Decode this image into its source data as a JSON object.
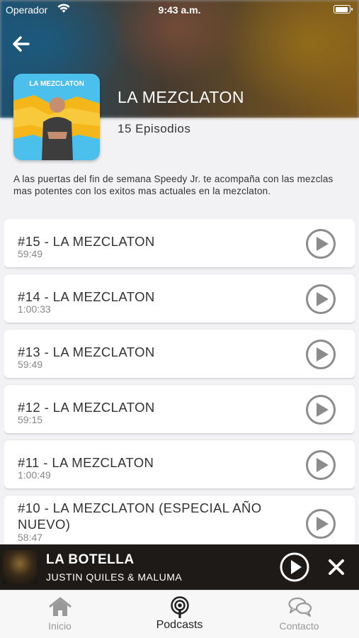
{
  "status_bar": {
    "carrier": "Operador",
    "time": "9:43 a.m.",
    "wifi_icon": "wifi-icon",
    "battery_icon": "battery-icon"
  },
  "header": {
    "back_icon": "arrow-left-icon"
  },
  "podcast": {
    "cover_text": "LA MEZCLATON",
    "title": "LA MEZCLATON",
    "episodes_count": "15 Episodios",
    "description": "A las puertas del fin de semana Speedy Jr. te acompaña con las mezclas mas potentes con los exitos mas actuales en la mezclaton."
  },
  "episodes": [
    {
      "title": "#15 - LA MEZCLATON",
      "duration": "59:49"
    },
    {
      "title": "#14 - LA MEZCLATON",
      "duration": "1:00:33"
    },
    {
      "title": "#13 - LA MEZCLATON",
      "duration": "59:49"
    },
    {
      "title": "#12 - LA MEZCLATON",
      "duration": "59:15"
    },
    {
      "title": "#11 - LA MEZCLATON",
      "duration": "1:00:49"
    },
    {
      "title": "#10 - LA MEZCLATON (ESPECIAL AÑO NUEVO)",
      "duration": "58:47"
    }
  ],
  "mini_player": {
    "title": "LA BOTELLA",
    "artist": "JUSTIN QUILES & MALUMA",
    "play_icon": "play-circle-icon",
    "close_icon": "close-icon"
  },
  "tab_bar": {
    "tabs": [
      {
        "label": "Inicio",
        "icon": "home-icon",
        "active": false
      },
      {
        "label": "Podcasts",
        "icon": "podcast-icon",
        "active": true
      },
      {
        "label": "Contacto",
        "icon": "chat-bubbles-icon",
        "active": false
      }
    ]
  },
  "colors": {
    "accent_active": "#222222",
    "inactive": "#999999",
    "play_icon_gray": "#8c8c8c",
    "player_bg": "#1e1a17"
  }
}
